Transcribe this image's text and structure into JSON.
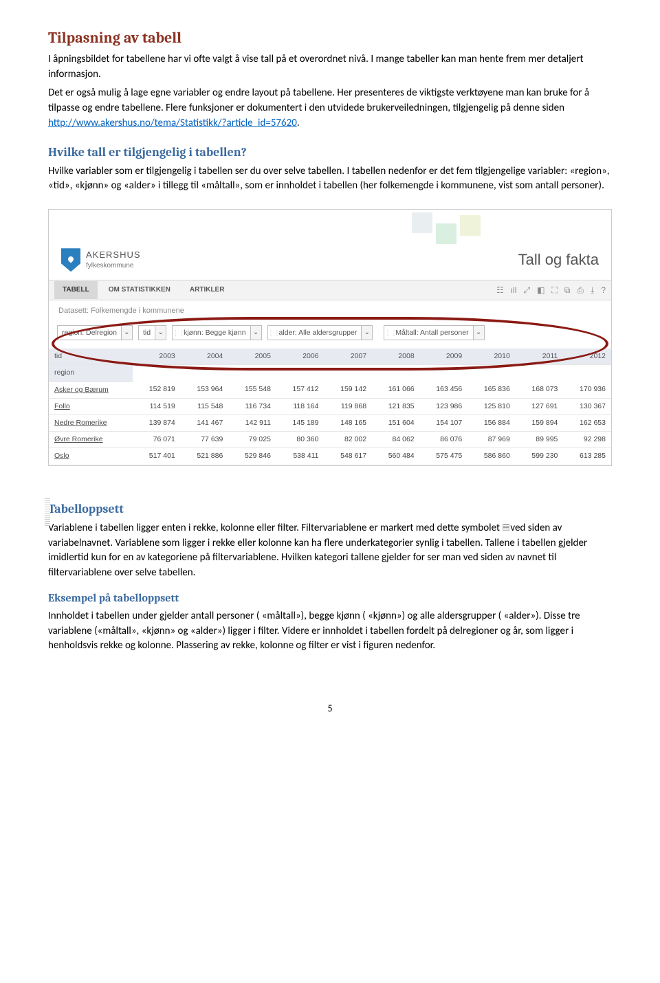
{
  "h1": "Tilpasning av tabell",
  "p1": "I åpningsbildet for tabellene har vi ofte valgt å vise tall på et overordnet nivå. I mange tabeller kan man hente frem mer detaljert informasjon.",
  "p2a": "Det er også mulig å lage egne variabler og endre layout på tabellene. Her presenteres de viktigste verktøyene man kan bruke for å tilpasse og endre tabellene. Flere funksjoner er dokumentert i den utvidede brukerveiledningen, tilgjengelig på denne siden ",
  "link": "http://www.akershus.no/tema/Statistikk/?article_id=57620",
  "p2b": ".",
  "h2a": "Hvilke tall er tilgjengelig i tabellen?",
  "p3": "Hvilke variabler som er tilgjengelig i tabellen ser du over selve tabellen. I tabellen nedenfor er det fem tilgjengelige variabler: «region», «tid», «kjønn» og «alder» i tillegg til «måltall», som er innholdet i tabellen (her folkemengde i kommunene, vist som antall personer).",
  "h2b": "Tabelloppsett",
  "p4a": "Variablene i tabellen ligger enten i rekke, kolonne eller filter. Filtervariablene er markert med dette symbolet ",
  "p4b": "ved siden av variabelnavnet. Variablene som ligger i rekke eller kolonne kan ha flere underkategorier synlig i tabellen. Tallene i tabellen gjelder imidlertid kun for en av kategoriene på filtervariablene. Hvilken kategori tallene gjelder for ser man ved siden av navnet til filtervariablene over selve tabellen.",
  "h3": "Eksempel på tabelloppsett",
  "p5": "Innholdet i tabellen under gjelder antall personer ( «måltall»), begge kjønn ( «kjønn») og alle aldersgrupper ( «alder»). Disse tre variablene («måltall», «kjønn» og «alder») ligger i filter. Videre er innholdet i tabellen fordelt på delregioner og år, som ligger i henholdsvis rekke og kolonne. Plassering av rekke, kolonne og filter er vist i figuren nedenfor.",
  "pagenum": "5",
  "shot": {
    "brand1": "AKERSHUS",
    "brand2": "fylkeskommune",
    "headline": "Tall og fakta",
    "tabs": [
      "TABELL",
      "OM STATISTIKKEN",
      "ARTIKLER"
    ],
    "toolicons": [
      "☷",
      "ıll",
      "⤢",
      "◧",
      "⛶",
      "⧉",
      "⎙",
      "⤓",
      "?"
    ],
    "dataset": "Datasett: Folkemengde i kommunene",
    "filters": [
      {
        "label": "region: Delregion",
        "filter": false
      },
      {
        "label": "tid",
        "filter": false
      },
      {
        "label": "kjønn: Begge kjønn",
        "filter": true
      },
      {
        "label": "alder: Alle aldersgrupper",
        "filter": true
      },
      {
        "label": "Måltall: Antall personer",
        "filter": true
      }
    ],
    "colhdr_left": "tid",
    "rowhdr_left": "region",
    "years": [
      "2003",
      "2004",
      "2005",
      "2006",
      "2007",
      "2008",
      "2009",
      "2010",
      "2011",
      "2012"
    ],
    "rows": [
      {
        "name": "Asker og Bærum",
        "vals": [
          "152 819",
          "153 964",
          "155 548",
          "157 412",
          "159 142",
          "161 066",
          "163 456",
          "165 836",
          "168 073",
          "170 936"
        ]
      },
      {
        "name": "Follo",
        "vals": [
          "114 519",
          "115 548",
          "116 734",
          "118 164",
          "119 868",
          "121 835",
          "123 986",
          "125 810",
          "127 691",
          "130 367"
        ]
      },
      {
        "name": "Nedre Romerike",
        "vals": [
          "139 874",
          "141 467",
          "142 911",
          "145 189",
          "148 165",
          "151 604",
          "154 107",
          "156 884",
          "159 894",
          "162 653"
        ]
      },
      {
        "name": "Øvre Romerike",
        "vals": [
          "76 071",
          "77 639",
          "79 025",
          "80 360",
          "82 002",
          "84 062",
          "86 076",
          "87 969",
          "89 995",
          "92 298"
        ]
      },
      {
        "name": "Oslo",
        "vals": [
          "517 401",
          "521 886",
          "529 846",
          "538 411",
          "548 617",
          "560 484",
          "575 475",
          "586 860",
          "599 230",
          "613 285"
        ]
      }
    ]
  }
}
